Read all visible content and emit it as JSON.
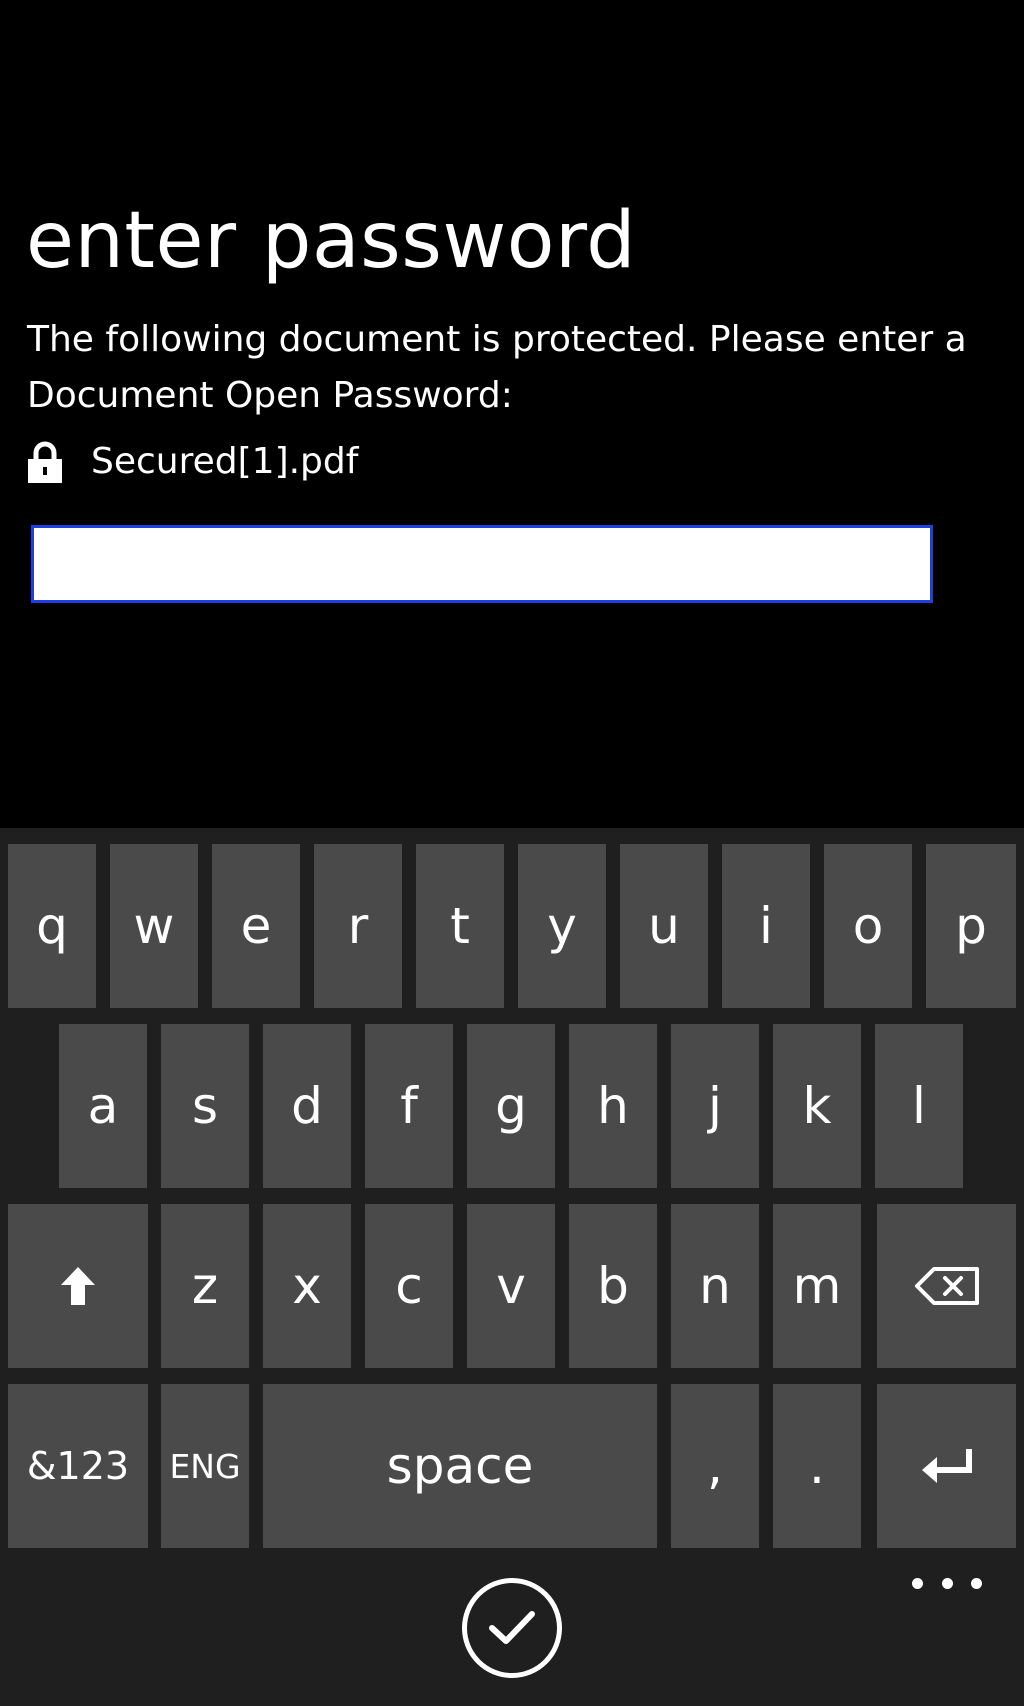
{
  "page": {
    "title": "enter password",
    "description": "The following document is protected. Please enter a Document Open Password:",
    "file_name": "Secured[1].pdf",
    "password_value": ""
  },
  "keyboard": {
    "row1": [
      "q",
      "w",
      "e",
      "r",
      "t",
      "y",
      "u",
      "i",
      "o",
      "p"
    ],
    "row2": [
      "a",
      "s",
      "d",
      "f",
      "g",
      "h",
      "j",
      "k",
      "l"
    ],
    "row3": [
      "z",
      "x",
      "c",
      "v",
      "b",
      "n",
      "m"
    ],
    "symbols_label": "&123",
    "language_label": "ENG",
    "space_label": "space",
    "comma_label": ",",
    "period_label": "."
  },
  "icons": {
    "file": "lock-icon",
    "shift": "shift-icon",
    "backspace": "backspace-icon",
    "enter": "enter-icon",
    "accept": "checkmark-icon",
    "more": "more-icon"
  },
  "colors": {
    "background": "#000000",
    "keyboard_background": "#1f1f1f",
    "key": "#4a4a4a",
    "input_border": "#1f3fe0",
    "text": "#ffffff"
  }
}
